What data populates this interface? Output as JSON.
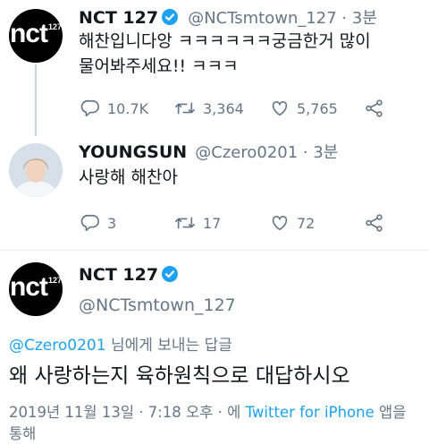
{
  "tweet1": {
    "name": "NCT 127",
    "handle_time": "@NCTsmtown_127 · 3분",
    "text_line1": "해찬입니다앙 ㅋㅋㅋㅋㅋㅋ궁금한거 많이",
    "text_line2": "물어봐주세요!! ㅋㅋㅋ",
    "replies": "10.7K",
    "retweets": "3,364",
    "likes": "5,765",
    "avatar_logo": "nct",
    "avatar_logo_sup": "127"
  },
  "tweet2": {
    "name": "YOUNGSUN",
    "handle_time": "@Czero0201 · 3분",
    "text": "사랑해 해찬아",
    "replies": "3",
    "retweets": "17",
    "likes": "72"
  },
  "tweet3": {
    "name": "NCT 127",
    "handle": "@NCTsmtown_127",
    "reply_to_handle": "@Czero0201",
    "reply_to_suffix": " 님에게 보내는 답글",
    "text": "왜 사랑하는지 육하원칙으로 대답하시오",
    "meta_date": "2019년 11월 13일 · 7:18 오후 · 에 ",
    "meta_source": "Twitter for iPhone",
    "meta_suffix": " 앱을",
    "meta_line2": "통해",
    "avatar_logo": "nct",
    "avatar_logo_sup": "127"
  },
  "colors": {
    "accent": "#1da1f2",
    "muted": "#657786",
    "text": "#14171a",
    "divider": "#e6ecf0"
  },
  "icons": [
    "verified-badge-icon",
    "reply-icon",
    "retweet-icon",
    "like-icon",
    "share-icon"
  ]
}
